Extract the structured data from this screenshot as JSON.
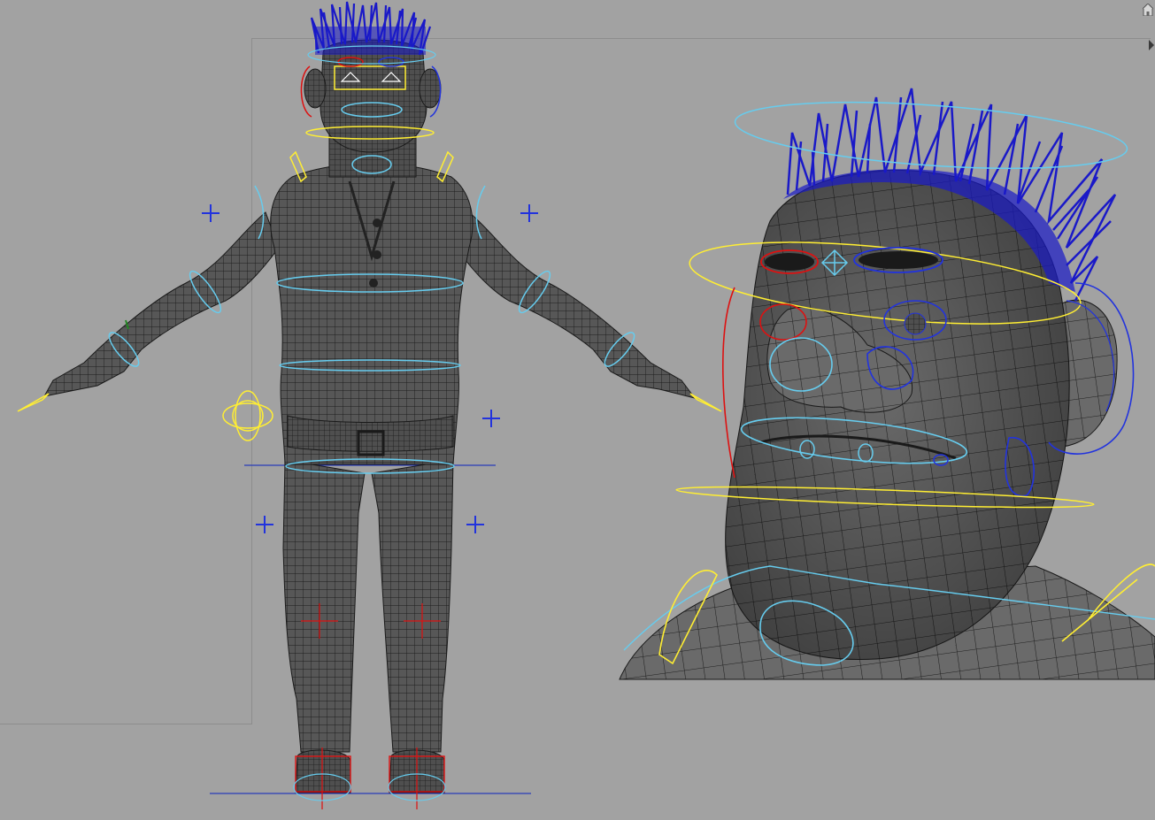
{
  "app": {
    "viewport_bg": "#a2a2a2",
    "colors": {
      "mesh_fill": "#4e4e4e",
      "mesh_dark": "#333333",
      "wire": "#1c1c1c",
      "hair": "#1a19c8",
      "ctrl_cyan": "#66ccee",
      "ctrl_yellow": "#ffee33",
      "ctrl_blue": "#2233dd",
      "ctrl_red": "#dd1111",
      "ground": "#2a3cb8"
    },
    "icons": [
      "home-icon",
      "panel-expand-arrow-icon"
    ]
  }
}
